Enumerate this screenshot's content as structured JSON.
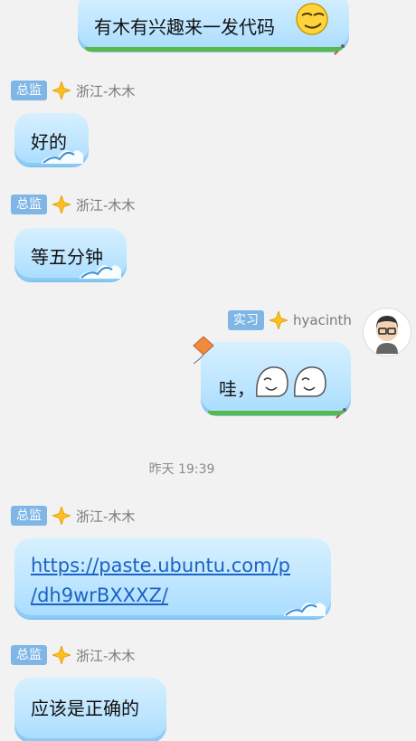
{
  "messages": [
    {
      "id": "m1",
      "sender_badge": "",
      "sender_name": "",
      "text": "有木有兴趣来一发代码",
      "emoji": "smirk-face-icon"
    },
    {
      "id": "m2",
      "sender_badge": "总监",
      "sender_name": "浙江-木木",
      "text": "好的"
    },
    {
      "id": "m3",
      "sender_badge": "总监",
      "sender_name": "浙江-木木",
      "text": "等五分钟"
    },
    {
      "id": "m4",
      "sender_badge": "实习",
      "sender_name": "hyacinth",
      "text": "哇，",
      "emoji": "ghost-sticker-icon"
    },
    {
      "id": "time1",
      "timestamp": "昨天 19:39"
    },
    {
      "id": "m5",
      "sender_badge": "总监",
      "sender_name": "浙江-木木",
      "link_line1": "https://paste.ubuntu.com/p",
      "link_line2": "/dh9wrBXXXZ/"
    },
    {
      "id": "m6",
      "sender_badge": "总监",
      "sender_name": "浙江-木木",
      "text": "应该是正确的"
    }
  ],
  "colors": {
    "bubble": "#bfe6ff",
    "badge": "#7fb6e6",
    "link": "#1a62c4",
    "background": "#f2f2f2"
  }
}
